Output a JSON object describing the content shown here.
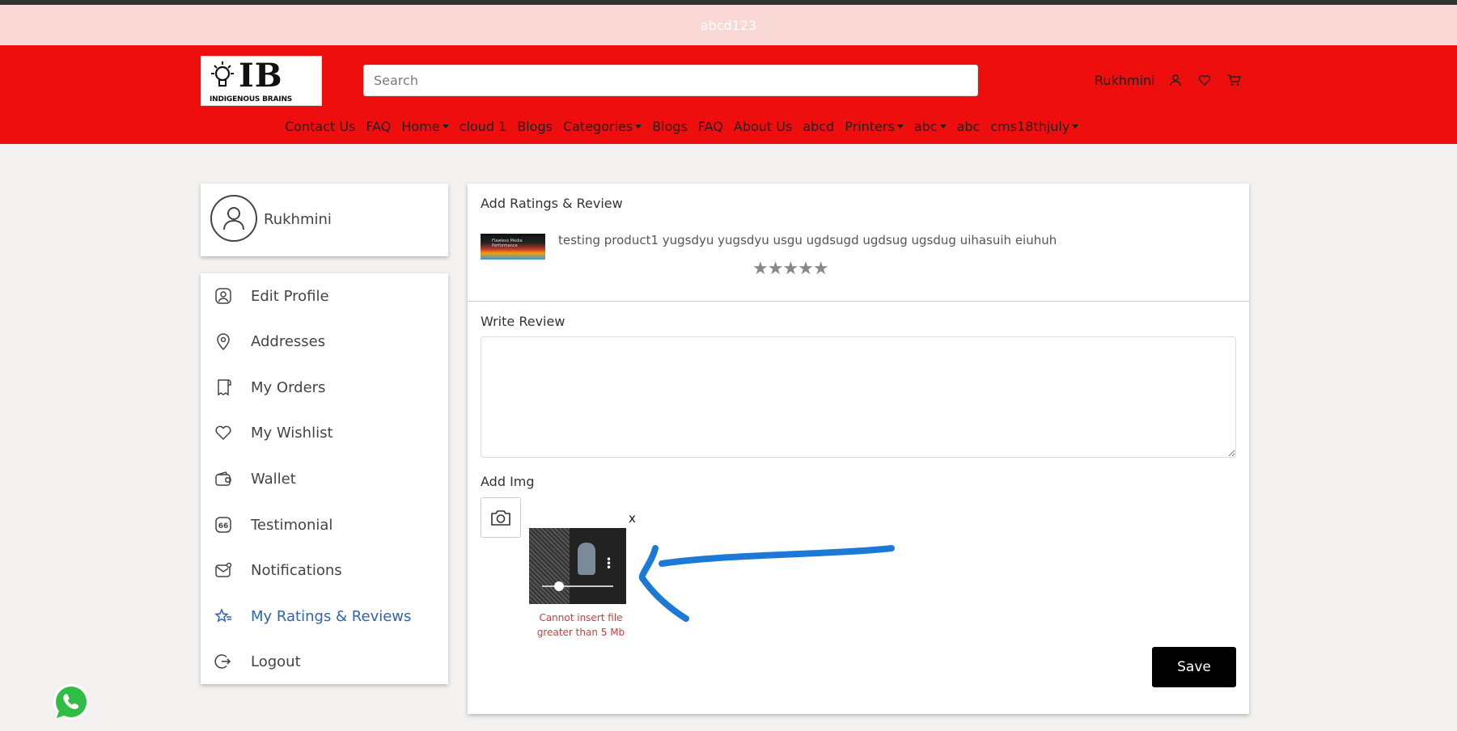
{
  "promo": {
    "text": "abcd123"
  },
  "header": {
    "logo_mark": "IB",
    "logo_sub": "INDIGENOUS BRAINS",
    "search_placeholder": "Search",
    "username": "Rukhmini",
    "nav": [
      {
        "label": "Contact Us",
        "caret": false
      },
      {
        "label": "FAQ",
        "caret": false
      },
      {
        "label": "Home",
        "caret": true
      },
      {
        "label": "cloud 1",
        "caret": false
      },
      {
        "label": "Blogs",
        "caret": false
      },
      {
        "label": "Categories",
        "caret": true
      },
      {
        "label": "Blogs",
        "caret": false
      },
      {
        "label": "FAQ",
        "caret": false
      },
      {
        "label": "About Us",
        "caret": false
      },
      {
        "label": "abcd",
        "caret": false
      },
      {
        "label": "Printers",
        "caret": true
      },
      {
        "label": "abc",
        "caret": true
      },
      {
        "label": "abc",
        "caret": false
      },
      {
        "label": "cms18thjuly",
        "caret": true
      }
    ]
  },
  "profile": {
    "name": "Rukhmini"
  },
  "menu": [
    {
      "label": "Edit Profile",
      "icon": "user-icon"
    },
    {
      "label": "Addresses",
      "icon": "location-icon"
    },
    {
      "label": "My Orders",
      "icon": "receipt-icon"
    },
    {
      "label": "My Wishlist",
      "icon": "heart-icon"
    },
    {
      "label": "Wallet",
      "icon": "wallet-icon"
    },
    {
      "label": "Testimonial",
      "icon": "quote-icon"
    },
    {
      "label": "Notifications",
      "icon": "mail-icon"
    },
    {
      "label": "My Ratings & Reviews",
      "icon": "star-icon",
      "active": true
    },
    {
      "label": "Logout",
      "icon": "logout-icon"
    }
  ],
  "review": {
    "title": "Add Ratings & Review",
    "product_thumb_text": "Flawless Media Performance",
    "product_name": "testing product1 yugsdyu yugsdyu usgu ugdsugd ugdsug ugsdug uihasuih eiuhuh",
    "stars": "★★★★★",
    "write_label": "Write Review",
    "review_text": "",
    "add_img_label": "Add Img",
    "remove_label": "x",
    "error_text": "Cannot insert file greater than 5 Mb",
    "save_label": "Save"
  },
  "colors": {
    "brand_red": "#ee0e0e",
    "promo_bg": "#f9d8d6",
    "active_blue": "#2d64b3",
    "error_red": "#d63a3a",
    "arrow_blue": "#1c7ad6"
  }
}
